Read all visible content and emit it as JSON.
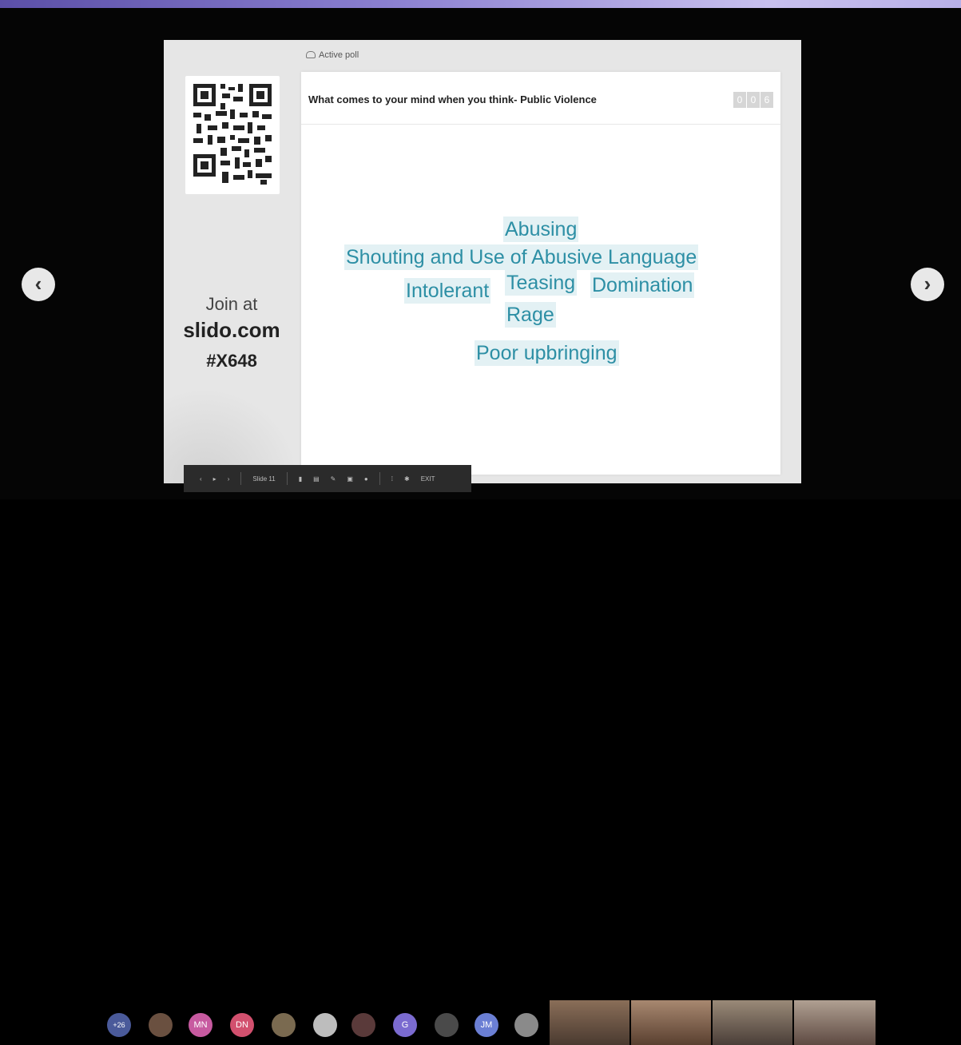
{
  "slide": {
    "active_poll_label": "Active poll",
    "question": "What comes to your mind when you think- Public Violence",
    "counter": [
      "0",
      "0",
      "6"
    ],
    "join": {
      "line1": "Join at",
      "line2": "slido.com",
      "line3": "#X648"
    },
    "words": [
      {
        "text": "Abusing"
      },
      {
        "text": "Shouting and Use of Abusive Language"
      },
      {
        "text": "Intolerant"
      },
      {
        "text": "Teasing"
      },
      {
        "text": "Domination"
      },
      {
        "text": "Rage"
      },
      {
        "text": "Poor upbringing"
      }
    ]
  },
  "toolbar": {
    "slide_label": "Slide 11",
    "exit_label": "EXIT"
  },
  "participants": {
    "overflow_count": "+26",
    "initials": [
      "MN",
      "DN",
      "G",
      "JM"
    ]
  },
  "colors": {
    "word_text": "#2d8fa5",
    "word_bg": "#e3f1f4",
    "slide_bg": "#e6e6e6"
  }
}
